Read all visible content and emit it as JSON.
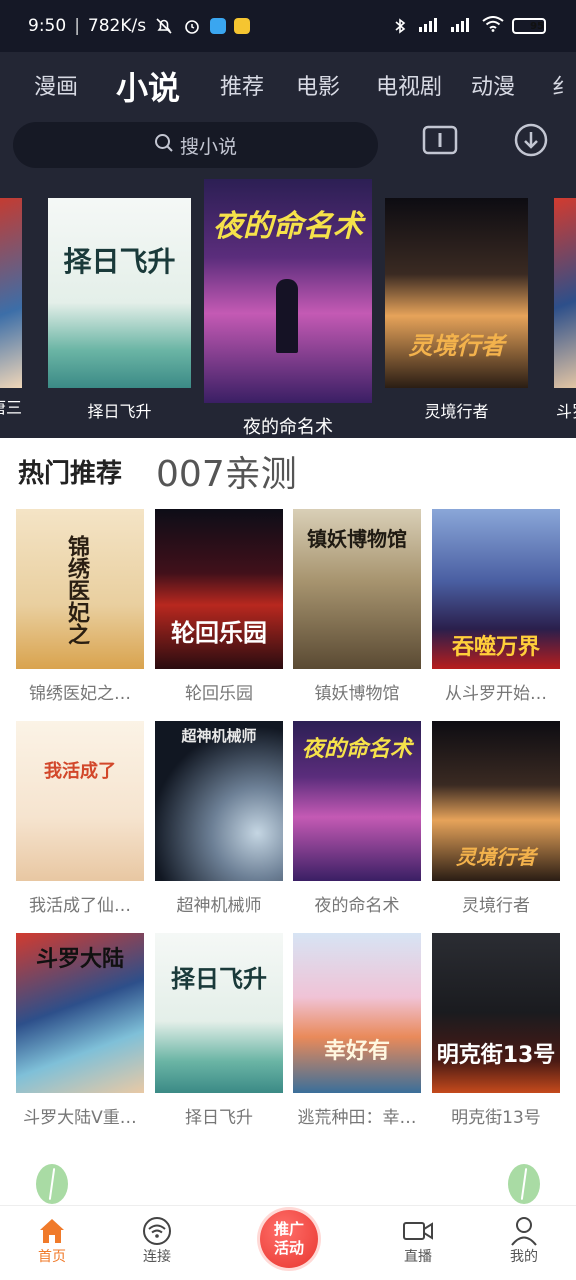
{
  "status_bar": {
    "time": "9:50",
    "network_speed": "782K/s",
    "battery": "95"
  },
  "tabs": [
    {
      "label": "漫画"
    },
    {
      "label": "小说"
    },
    {
      "label": "推荐"
    },
    {
      "label": "电影"
    },
    {
      "label": "电视剧"
    },
    {
      "label": "动漫"
    },
    {
      "label": "纟"
    }
  ],
  "active_tab": "小说",
  "search": {
    "placeholder": "搜小说"
  },
  "carousel": [
    {
      "title": "唐三",
      "cover_text": "唐三"
    },
    {
      "title": "择日飞升",
      "cover_text": "择日飞升"
    },
    {
      "title": "夜的命名术",
      "cover_text": "夜的命名术"
    },
    {
      "title": "灵境行者",
      "cover_text": "灵境行者"
    },
    {
      "title": "斗罗",
      "cover_text": "唐三"
    }
  ],
  "section": {
    "title": "热门推荐",
    "subtitle": "007亲测"
  },
  "books": [
    {
      "name": "锦绣医妃之…",
      "cover_text": "锦绣医妃之"
    },
    {
      "name": "轮回乐园",
      "cover_text": "轮回乐园"
    },
    {
      "name": "镇妖博物馆",
      "cover_text": "镇妖博物馆"
    },
    {
      "name": "从斗罗开始…",
      "cover_text": "吞噬万界"
    },
    {
      "name": "我活成了仙…",
      "cover_text": "我活成了"
    },
    {
      "name": "超神机械师",
      "cover_text": "超神机械师"
    },
    {
      "name": "夜的命名术",
      "cover_text": "夜的命名术"
    },
    {
      "name": "灵境行者",
      "cover_text": "灵境行者"
    },
    {
      "name": "斗罗大陆V重…",
      "cover_text": "斗罗大陆"
    },
    {
      "name": "择日飞升",
      "cover_text": "择日飞升"
    },
    {
      "name": "逃荒种田：幸…",
      "cover_text": "幸好有"
    },
    {
      "name": "明克街13号",
      "cover_text": "明克街13号"
    }
  ],
  "bottom_nav": {
    "home": "首页",
    "connect": "连接",
    "promo": "推广活动",
    "live": "直播",
    "mine": "我的"
  },
  "colors": {
    "header_bg": "#232634",
    "accent": "#f07a2a",
    "promo_red": "#e8362f"
  }
}
